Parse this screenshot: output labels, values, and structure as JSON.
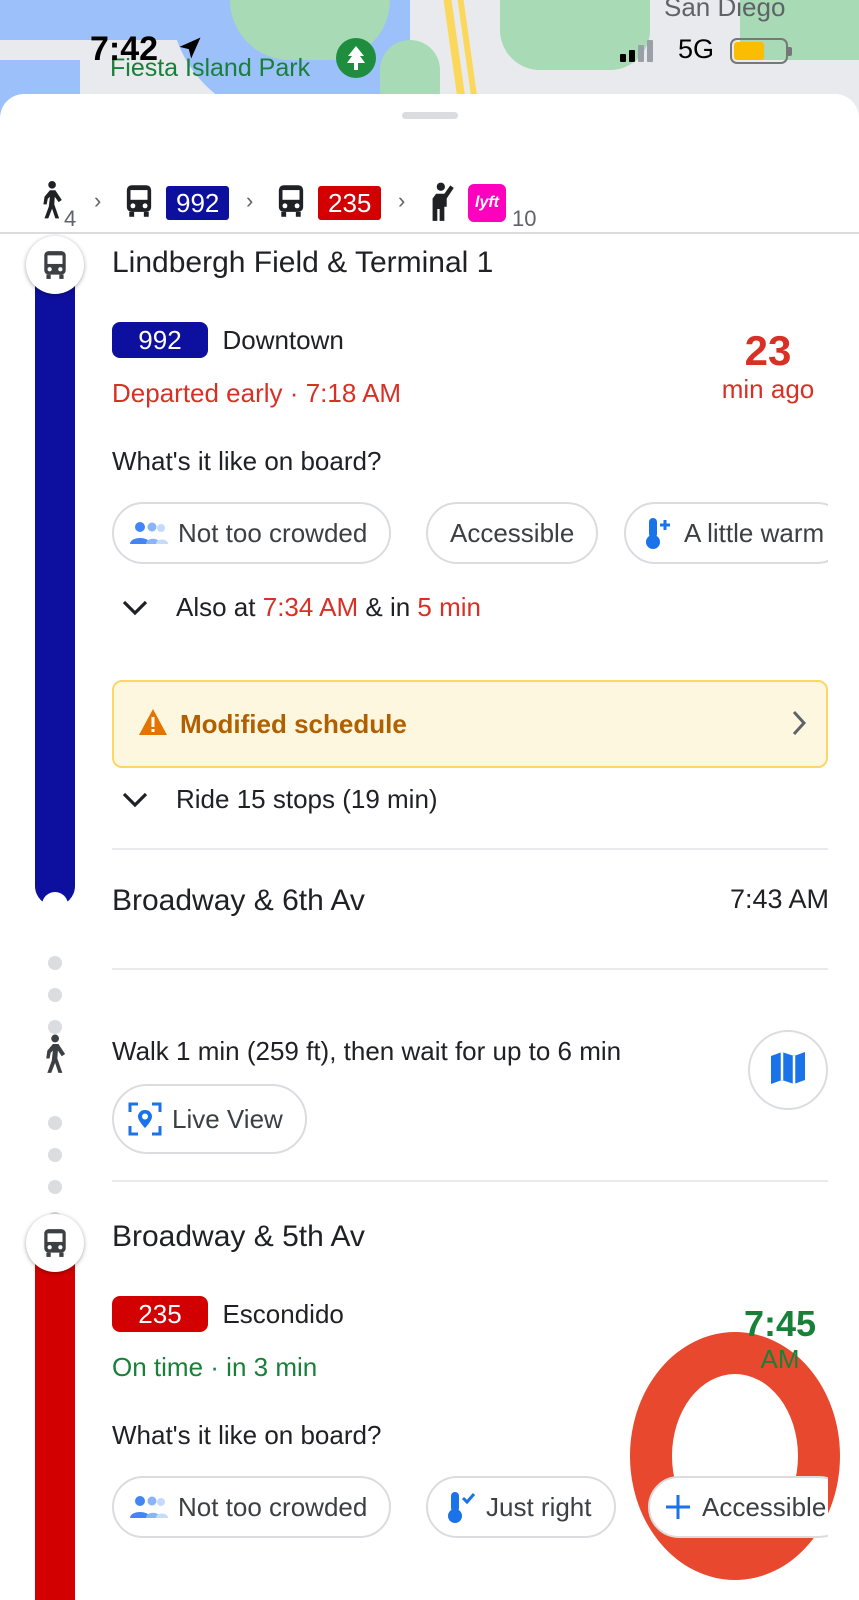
{
  "status_bar": {
    "time": "7:42",
    "network": "5G",
    "battery_level": 0.6
  },
  "map": {
    "park_label": "Fiesta Island Park",
    "city_label": "San Diego"
  },
  "summary": {
    "walk_minutes": "4",
    "route1": "992",
    "route2": "235",
    "lyft_logo": "lyft",
    "lyft_minutes": "10"
  },
  "leg1": {
    "origin": "Lindbergh Field & Terminal 1",
    "route": "992",
    "route_color": "#0d0f9e",
    "headsign": "Downtown",
    "status": "Departed early",
    "separator": "·",
    "departure_time": "7:18 AM",
    "eta_value": "23",
    "eta_unit": "min ago",
    "onboard_question": "What's it like on board?",
    "chips": [
      "Not too crowded",
      "Accessible",
      "A little warm"
    ],
    "also_at_prefix": "Also at",
    "also_at_time": "7:34 AM",
    "also_at_mid": "& in",
    "also_at_in": "5 min",
    "notice": "Modified schedule",
    "ride_summary": "Ride 15 stops (19 min)",
    "destination": "Broadway & 6th Av",
    "arrival_time": "7:43 AM"
  },
  "walk": {
    "text": "Walk 1 min (259 ft), then wait for up to 6 min",
    "live_view": "Live View"
  },
  "leg2": {
    "origin": "Broadway & 5th Av",
    "route": "235",
    "route_color": "#d20000",
    "headsign": "Escondido",
    "status": "On time",
    "separator": "·",
    "in_text": "in 3 min",
    "time_value": "7:45",
    "time_unit": "AM",
    "onboard_question": "What's it like on board?",
    "chips": [
      "Not too crowded",
      "Just right",
      "Accessible"
    ]
  }
}
